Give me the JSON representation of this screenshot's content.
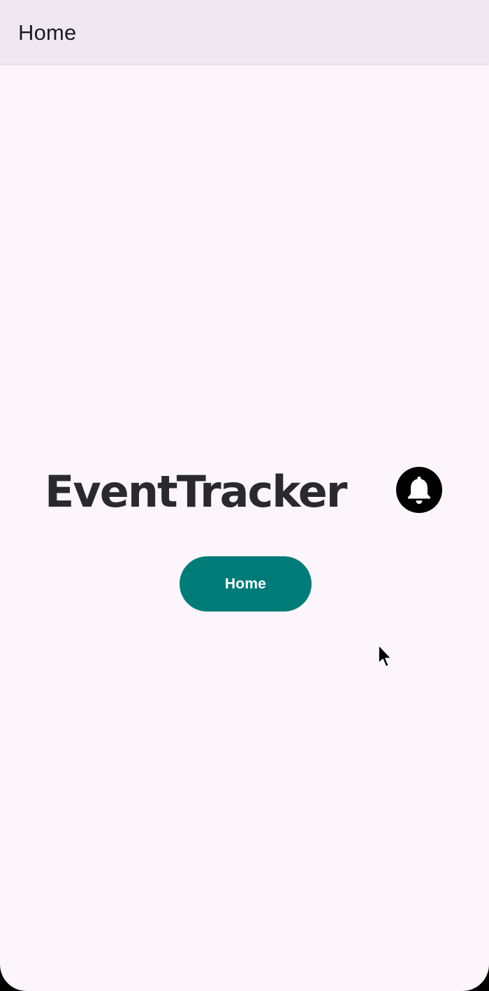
{
  "top_bar": {
    "title": "Home"
  },
  "logo": {
    "text": "EventTracker",
    "icon": "bell-icon"
  },
  "main": {
    "home_button_label": "Home"
  },
  "colors": {
    "background": "#FCF6FC",
    "top_bar": "#EFE8F3",
    "accent": "#007B78",
    "logo_text": "#2B2930"
  }
}
